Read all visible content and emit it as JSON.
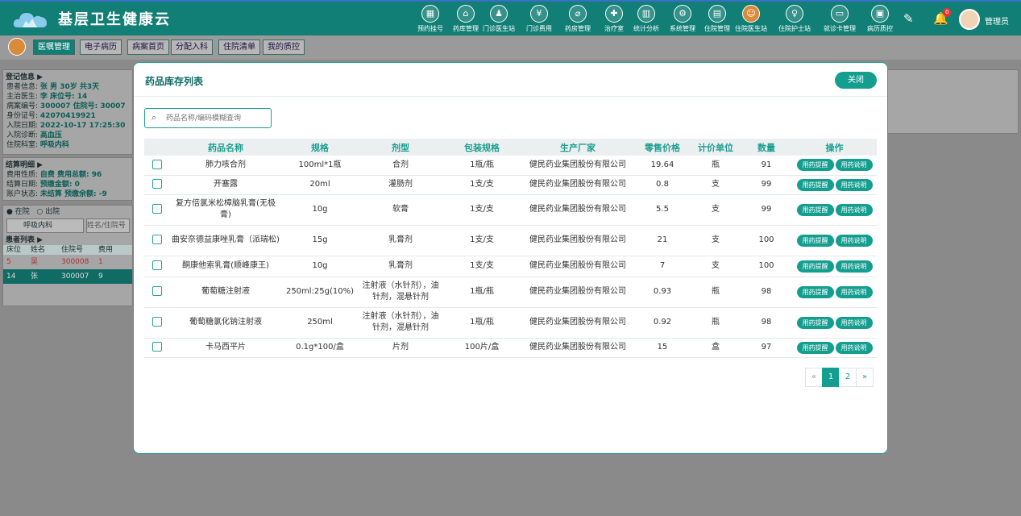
{
  "header": {
    "title": "基层卫生健康云",
    "user": "管理员",
    "notify_count": "0",
    "nav": [
      "预约挂号",
      "药库管理",
      "门诊医生站",
      "门诊费用",
      "药房管理",
      "治疗室",
      "统计分析",
      "系统管理",
      "住院管理",
      "住院医生站",
      "住院护士站",
      "就诊卡管理",
      "病历质控"
    ],
    "nav_active": "住院医生站"
  },
  "tabs": [
    "医嘱管理",
    "电子病历",
    "病案首页",
    "分配入科",
    "住院清单",
    "我的质控"
  ],
  "tab_active": "医嘱管理",
  "left": {
    "reg_title": "登记信息",
    "reg_rows": [
      {
        "k": "患者信息:",
        "v": "张   男 30岁 共3天"
      },
      {
        "k": "主治医生:",
        "v": "李    床位号: 14"
      },
      {
        "k": "病案编号:",
        "v": "300007  住院号: 30007"
      },
      {
        "k": "身份证号:",
        "v": "42070419921"
      },
      {
        "k": "入院日期:",
        "v": "2022-10-17 17:25:30"
      },
      {
        "k": "入院诊断:",
        "v": "高血压"
      },
      {
        "k": "住院科室:",
        "v": "呼吸内科"
      }
    ],
    "settle_title": "结算明细",
    "settle_rows": [
      {
        "k": "费用性质:",
        "v": "自费  费用总额: 96"
      },
      {
        "k": "结算日期:",
        "v": "     预缴金额: 0"
      },
      {
        "k": "账户状态:",
        "v": "未结算  预缴余额: -9"
      }
    ],
    "status_in": "在院",
    "status_out": "出院",
    "dept": "呼吸内科",
    "name_placeholder": "姓名/住院号",
    "plist_title": "患者列表",
    "plist_headers": [
      "床位",
      "姓名",
      "住院号",
      "费用"
    ],
    "plist_rows": [
      [
        "5",
        "吴",
        "300008",
        "1"
      ],
      [
        "14",
        "张",
        "300007",
        "9"
      ]
    ]
  },
  "modal": {
    "title": "药品库存列表",
    "close": "关闭",
    "search_placeholder": "药品名称/编码模糊查询",
    "headers": [
      "药品名称",
      "规格",
      "剂型",
      "包装规格",
      "生产厂家",
      "零售价格",
      "计价单位",
      "数量",
      "操作"
    ],
    "rows": [
      [
        "肺力咳合剂",
        "100ml*1瓶",
        "合剂",
        "1瓶/瓶",
        "健民药业集团股份有限公司",
        "19.64",
        "瓶",
        "91"
      ],
      [
        "开塞露",
        "20ml",
        "灌肠剂",
        "1支/支",
        "健民药业集团股份有限公司",
        "0.8",
        "支",
        "99"
      ],
      [
        "复方倍氯米松樟脑乳膏(无极膏)",
        "10g",
        "软膏",
        "1支/支",
        "健民药业集团股份有限公司",
        "5.5",
        "支",
        "99"
      ],
      [
        "曲安奈德益康唑乳膏（派瑞松)",
        "15g",
        "乳膏剂",
        "1支/支",
        "健民药业集团股份有限公司",
        "21",
        "支",
        "100"
      ],
      [
        "酮康他索乳膏(顺峰康王)",
        "10g",
        "乳膏剂",
        "1支/支",
        "健民药业集团股份有限公司",
        "7",
        "支",
        "100"
      ],
      [
        "葡萄糖注射液",
        "250ml:25g(10%)",
        "注射液（水针剂），油针剂，混悬针剂",
        "1瓶/瓶",
        "健民药业集团股份有限公司",
        "0.93",
        "瓶",
        "98"
      ],
      [
        "葡萄糖氯化钠注射液",
        "250ml",
        "注射液（水针剂），油针剂，混悬针剂",
        "1瓶/瓶",
        "健民药业集团股份有限公司",
        "0.92",
        "瓶",
        "98"
      ],
      [
        "卡马西平片",
        "0.1g*100/盒",
        "片剂",
        "100片/盒",
        "健民药业集团股份有限公司",
        "15",
        "盒",
        "97"
      ]
    ],
    "op1": "用药提醒",
    "op2": "用药说明",
    "pager": {
      "prev": "«",
      "pages": [
        "1",
        "2"
      ],
      "current": "1",
      "next": "»"
    }
  }
}
